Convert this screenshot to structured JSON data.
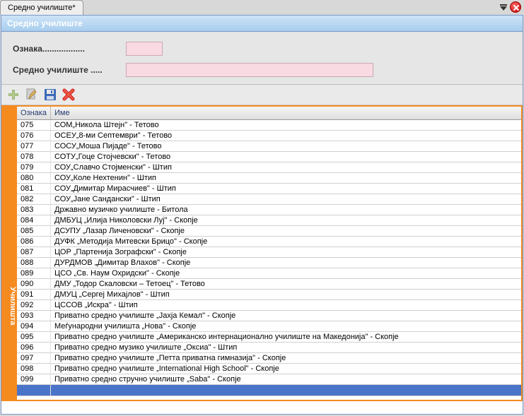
{
  "tab": {
    "title": "Средно училиште*"
  },
  "panel": {
    "title": "Средно училиште"
  },
  "form": {
    "label_code": "Ознака..................",
    "label_name": "Средно училиште .....",
    "value_code": "",
    "value_name": ""
  },
  "toolbar": {
    "add": "add",
    "edit": "edit",
    "save": "save",
    "delete": "delete"
  },
  "sideTab": "Училишта",
  "grid": {
    "headers": {
      "code": "Ознака",
      "name": "Име"
    },
    "rows": [
      {
        "code": "075",
        "name": "СОМ„Никола Штејн\" - Тетово"
      },
      {
        "code": "076",
        "name": "ОСЕУ„8-ми Септември\" - Тетово"
      },
      {
        "code": "077",
        "name": "СОСУ„Моша Пијаде\" - Тетово"
      },
      {
        "code": "078",
        "name": "СОТУ„Гоце Стојчевски\" - Тетово"
      },
      {
        "code": "079",
        "name": "СОУ„Славчо Стојменски\" - Штип"
      },
      {
        "code": "080",
        "name": "СОУ„Коле Нехтенин\" - Штип"
      },
      {
        "code": "081",
        "name": "СОУ„Димитар Мирасчиев\" - Штип"
      },
      {
        "code": "082",
        "name": "СОУ„Јане Сандански\" - Штип"
      },
      {
        "code": "083",
        "name": "Државно музичко училиште - Битола"
      },
      {
        "code": "084",
        "name": "ДМБУЦ „Илија Николовски Луј\" - Скопје"
      },
      {
        "code": "085",
        "name": "ДСУПУ „Лазар Личеновски\" - Скопје"
      },
      {
        "code": "086",
        "name": "ДУФК „Методија Митевски Брицо\" - Скопје"
      },
      {
        "code": "087",
        "name": "ЦОР „Партенија Зографски\" - Скопје"
      },
      {
        "code": "088",
        "name": "ДУРДМОВ „Димитар Влахов\" - Скопје"
      },
      {
        "code": "089",
        "name": "ЦСО „Св. Наум Охридски\" - Скопје"
      },
      {
        "code": "090",
        "name": "ДМУ „Тодор Скаловски – Тетоец\" - Тетово"
      },
      {
        "code": "091",
        "name": "ДМУЦ „Сергеј Михајлов\" - Штип"
      },
      {
        "code": "092",
        "name": "ЦССОВ „Искра\" - Штип"
      },
      {
        "code": "093",
        "name": "Приватно средно училиште „Јахја Кемал\" - Скопје"
      },
      {
        "code": "094",
        "name": "Меѓународни училишта „Нова\" - Скопје"
      },
      {
        "code": "095",
        "name": "Приватно средно училиште „Американско интернационално училиште на Македонија\" - Скопје"
      },
      {
        "code": "096",
        "name": "Приватно средно музико училиште „Оксиа\" - Штип"
      },
      {
        "code": "097",
        "name": "Приватно средно училиште „Петта приватна гимназија\" - Скопје"
      },
      {
        "code": "098",
        "name": "Приватно средно училиште „International High School\" - Скопје"
      },
      {
        "code": "099",
        "name": "Приватно средно стручно училиште „Saba\" - Скопје"
      }
    ],
    "selectedIndex": 25
  }
}
